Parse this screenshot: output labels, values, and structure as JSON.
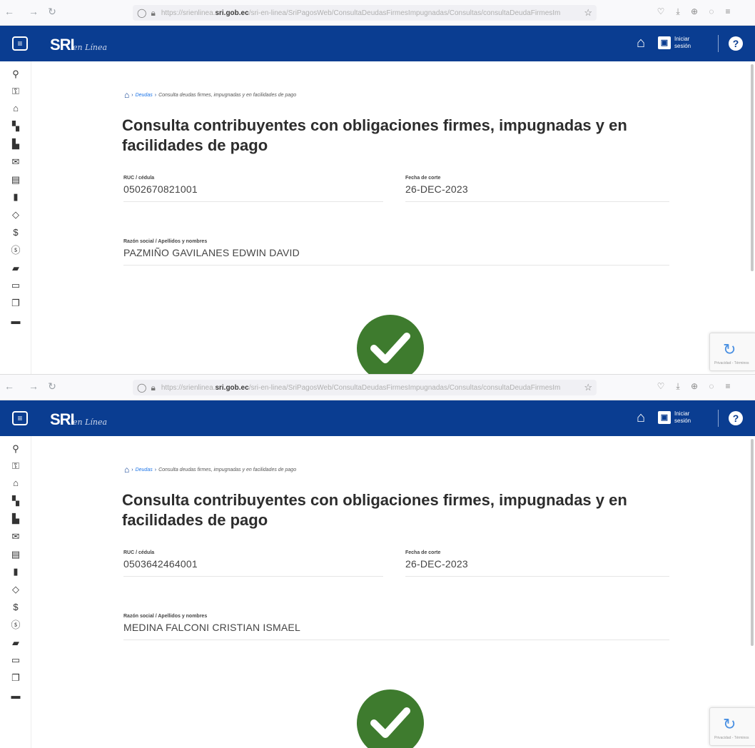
{
  "browser": {
    "url_prefix": "https://srienlinea.",
    "url_domain": "sri.gob.ec",
    "url_path": "/sri-en-linea/SriPagosWeb/ConsultaDeudasFirmesImpugnadas/Consultas/consultaDeudaFirmesImpugnadas",
    "icons": [
      "back-icon",
      "forward-icon",
      "reload-icon",
      "shield-icon",
      "lock-icon",
      "star-icon",
      "pocket-icon",
      "download-icon",
      "extension-icon",
      "account-icon",
      "menu-icon"
    ]
  },
  "header": {
    "logo": "SRI",
    "logo_sub": "en Línea",
    "login_label": "Iniciar sesión"
  },
  "sidebar_icons": [
    "search-icon",
    "key-icon",
    "bank-icon",
    "car-icon",
    "factory-icon",
    "mail-icon",
    "document-icon",
    "file-icon",
    "tag-icon",
    "dollar-icon",
    "coin-icon",
    "truck-icon",
    "form-icon",
    "copy-icon",
    "printer-icon"
  ],
  "breadcrumb": {
    "link": "Deudas",
    "current": "Consulta deudas firmes, impugnadas y en facilidades de pago"
  },
  "page": {
    "title": "Consulta contribuyentes con obligaciones firmes, impugnadas y en facilidades de pago",
    "ruc_label": "RUC / cédula",
    "fecha_label": "Fecha de corte",
    "razon_label": "Razón social / Apellidos y nombres"
  },
  "records": [
    {
      "ruc": "0502670821001",
      "fecha": "26-DEC-2023",
      "razon": "PAZMIÑO GAVILANES EDWIN DAVID"
    },
    {
      "ruc": "0503642464001",
      "fecha": "26-DEC-2023",
      "razon": "MEDINA FALCONI CRISTIAN ISMAEL"
    }
  ],
  "recaptcha": {
    "text": "Privacidad - Términos"
  },
  "colors": {
    "brand": "#0a3d91",
    "success": "#3e7b2e"
  }
}
